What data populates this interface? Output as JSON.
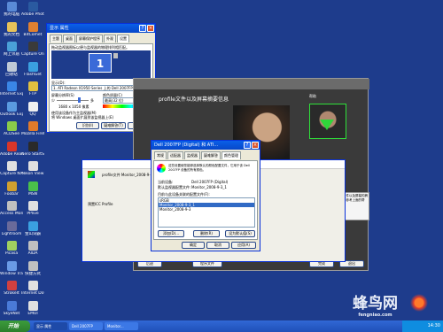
{
  "desktop": {
    "icons": [
      {
        "label": "我的电脑",
        "color": "#5a8ad6"
      },
      {
        "label": "我的文档",
        "color": "#e6c25a"
      },
      {
        "label": "网上邻居",
        "color": "#4aa0d8"
      },
      {
        "label": "回收站",
        "color": "#bfcad6"
      },
      {
        "label": "Internet Explorer",
        "color": "#3a86e6"
      },
      {
        "label": "Outlook Express",
        "color": "#5a9ae0"
      },
      {
        "label": "ACDSee",
        "color": "#8acb4a"
      },
      {
        "label": "Adobe Reader 6",
        "color": "#d8362a"
      },
      {
        "label": "Capture NX",
        "color": "#e0e0e0"
      },
      {
        "label": "Foobar",
        "color": "#d0a030"
      },
      {
        "label": "Access Monitor",
        "color": "#c0c0c0"
      },
      {
        "label": "Lightroom",
        "color": "#6a6a9a"
      },
      {
        "label": "Picasa",
        "color": "#a0d060"
      },
      {
        "label": "Window Tray",
        "color": "#6a9ae6"
      },
      {
        "label": "StrokeIt",
        "color": "#d04040"
      },
      {
        "label": "SkyeNet",
        "color": "#4a7ad8"
      },
      {
        "label": "Adobe Photo",
        "color": "#2a5aa0"
      },
      {
        "label": "BitComet",
        "color": "#e08030"
      },
      {
        "label": "Capture One",
        "color": "#3a3a3a"
      },
      {
        "label": "FlashGet",
        "color": "#3aa0e0"
      },
      {
        "label": "FTP",
        "color": "#e0c040"
      },
      {
        "label": "QQ",
        "color": "#f0f0f0"
      },
      {
        "label": "Mozilla Firefox",
        "color": "#e07a2a"
      },
      {
        "label": "Nero StartSm",
        "color": "#2a2a2a"
      },
      {
        "label": "Nikon View",
        "color": "#e0e0e0"
      },
      {
        "label": "MSN",
        "color": "#4ac04a"
      },
      {
        "label": "PPlive",
        "color": "#e0e0e0"
      },
      {
        "label": "金山词霸",
        "color": "#3aa0e0"
      },
      {
        "label": "AIDA",
        "color": "#c0c0c0"
      },
      {
        "label": "快捷方式",
        "color": "#c0c0c0"
      },
      {
        "label": "Internet Download",
        "color": "#e0e0e0"
      },
      {
        "label": "EMUI",
        "color": "#e0e0e0"
      }
    ]
  },
  "display_props": {
    "title": "显示 属性",
    "tabs": [
      "主题",
      "桌面",
      "屏幕保护程序",
      "外观",
      "设置"
    ],
    "instruction": "拖动监视器图标以便与监视器的物理排列相匹配。",
    "monitor_num": "1",
    "display_label": "显示(D):",
    "display_value": "1. ATI Radeon X1950 Series 上的 Dell 2007FP (Digital)",
    "resolution_label": "屏幕分辨率(S)",
    "res_less": "少",
    "res_more": "多",
    "resolution": "1680 x 1050 像素",
    "color_label": "颜色质量(C)",
    "color_value": "最高(32 位)",
    "checkbox1": "使用该设备作为主监视器(M)",
    "checkbox2": "将 Windows 桌面扩展到该监视器上(E)",
    "btn_identify": "识别(I)",
    "btn_troubleshoot": "疑难解答(T)",
    "btn_advanced": "高级(V)",
    "btn_ok": "确定",
    "btn_cancel": "取消",
    "btn_apply": "应用(A)"
  },
  "calibration": {
    "heading": "profile文件以及屏幕摘要信息",
    "help_label": "帮助",
    "help_text": "这里将会显示配置文件以及屏幕的摘要信息。如有问题请参考上面的帮助。",
    "body_text": "Dell 2007FP 中的 profile 文件名为：\"Monitor_2008-9-3.icm\"，中承业设置完了显示器的 ICC profile 文件。",
    "profile_box": "Monitor_2008-9-3",
    "btn_back": "后退",
    "btn_prog": "程序文件",
    "btn_done": "完成",
    "btn_end": "退出"
  },
  "profile_dialog": {
    "title": "profile文件 Monitor_2008-9-3",
    "item": "预置ICC Profile"
  },
  "dell_props": {
    "title": "Dell 2007FP (Digital) 和 ATI...",
    "tabs": [
      "常规",
      "适配器",
      "监视器",
      "疑难解答",
      "颜色管理"
    ],
    "desc": "这些设置使您能够选择默认的颜色配置文件，它用于该 Dell 2007FP 设备的所有颜色。",
    "device_label": "当前设备:",
    "device_value": "Dell 2007FP (Digital)",
    "default_label": "默认监视器配置文件:",
    "default_value": "Monitor_2008-9-3_1",
    "list_label": "目前与此设备关联的配置文件(F):",
    "profiles": [
      "sRGB",
      "Monitor_2008-9-3_1",
      "Monitor_2008-9-3"
    ],
    "btn_add": "添加(D)...",
    "btn_remove": "删除(R)",
    "btn_default": "设为默认值(S)",
    "btn_ok": "确定",
    "btn_cancel": "取消",
    "btn_apply": "应用(A)"
  },
  "taskbar": {
    "start": "开始",
    "tasks": [
      "显示 属性",
      "Dell 2007FP",
      "Monitor..."
    ],
    "clock": "14:30"
  },
  "watermark": {
    "text": "蜂鸟网",
    "url": "fengniao.com"
  }
}
